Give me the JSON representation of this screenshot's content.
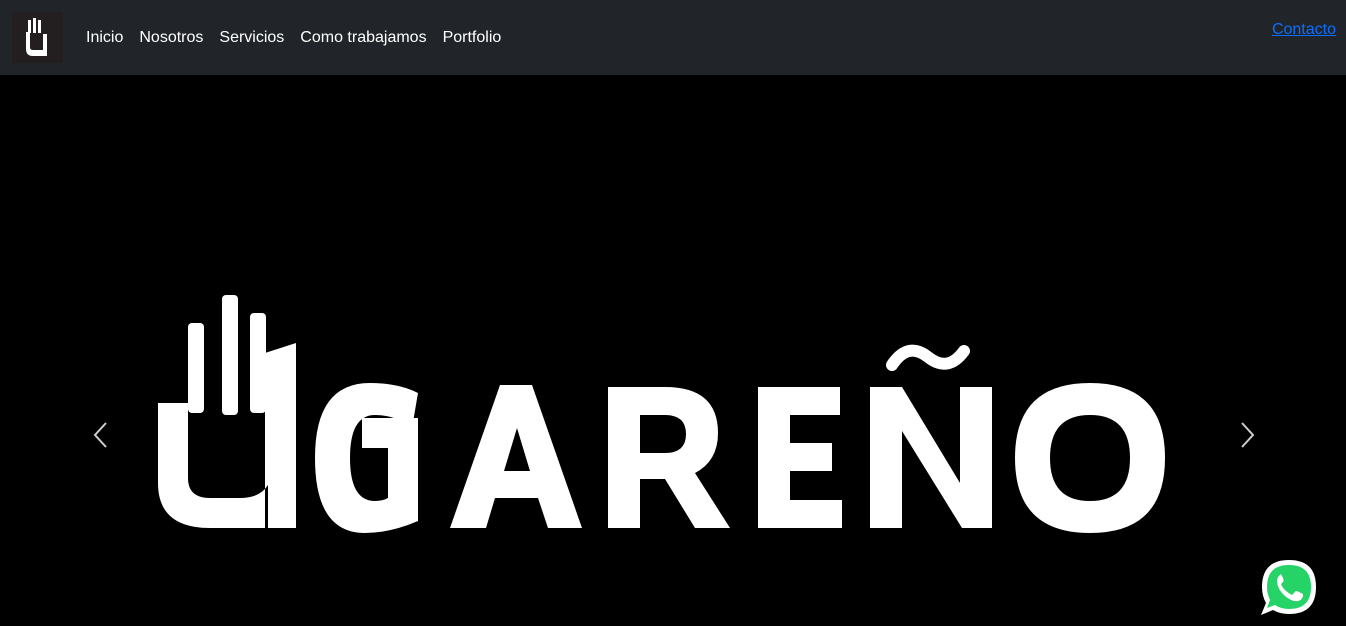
{
  "navbar": {
    "brand_icon": "ugareno-hand-logo-icon",
    "links": [
      {
        "label": "Inicio"
      },
      {
        "label": "Nosotros"
      },
      {
        "label": "Servicios"
      },
      {
        "label": "Como trabajamos"
      },
      {
        "label": "Portfolio"
      }
    ],
    "contact_label": "Contacto"
  },
  "carousel": {
    "slide_logo_text": "UGAREÑO",
    "prev_icon": "chevron-left-icon",
    "next_icon": "chevron-right-icon"
  },
  "floating": {
    "whatsapp_icon": "whatsapp-icon"
  },
  "colors": {
    "navbar_bg": "#212529",
    "page_bg": "#000000",
    "link": "#ffffff",
    "contact_link": "#0d6efd",
    "whatsapp_green": "#25d366"
  }
}
